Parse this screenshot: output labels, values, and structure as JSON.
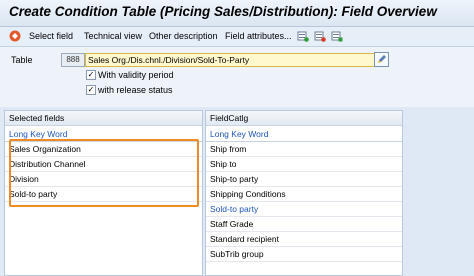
{
  "window": {
    "title": "Create Condition Table (Pricing Sales/Distribution): Field Overview"
  },
  "toolbar": {
    "select_field": "Select field",
    "technical_view": "Technical view",
    "other_description": "Other description",
    "field_attributes": "Field attributes..."
  },
  "form": {
    "table_label": "Table",
    "table_name": "888",
    "table_description": "Sales Org./Dis.chnl./Division/Sold-To-Party",
    "with_validity_period": {
      "label": "With validity period",
      "checked": true
    },
    "with_release_status": {
      "label": "with release status",
      "checked": true
    }
  },
  "selected_fields": {
    "header": "Selected fields",
    "column": "Long Key Word",
    "rows": [
      "Sales Organization",
      "Distribution Channel",
      "Division",
      "Sold-to party"
    ]
  },
  "field_catalog": {
    "header": "FieldCatlg",
    "column": "Long Key Word",
    "rows": [
      "Ship from",
      "Ship to",
      "Ship-to party",
      "Shipping Conditions",
      "Sold-to party",
      "Staff Grade",
      "Standard recipient",
      "SubTrib group"
    ]
  },
  "colors": {
    "link_blue": "#1f55b9",
    "highlight": "#f08a24"
  }
}
